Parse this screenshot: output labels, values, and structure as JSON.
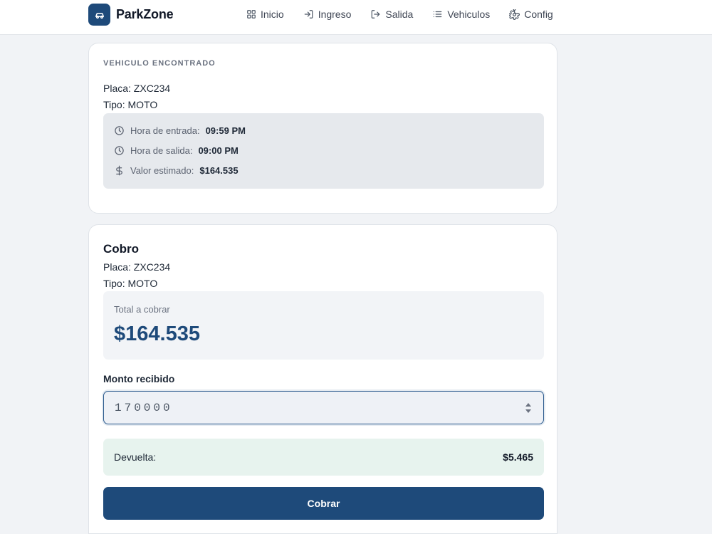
{
  "app": {
    "name": "ParkZone"
  },
  "nav": [
    {
      "label": "Inicio",
      "icon": "grid-icon"
    },
    {
      "label": "Ingreso",
      "icon": "login-arrow-icon"
    },
    {
      "label": "Salida",
      "icon": "logout-arrow-icon"
    },
    {
      "label": "Vehiculos",
      "icon": "list-icon"
    },
    {
      "label": "Config",
      "icon": "gear-icon"
    }
  ],
  "vehicle": {
    "eyebrow": "VEHICULO ENCONTRADO",
    "plate": "Placa: ZXC234",
    "type": "Tipo: MOTO",
    "entry_label": "Hora de entrada:",
    "entry_value": "09:59 PM",
    "exit_label": "Hora de salida:",
    "exit_value": "09:00 PM",
    "estimate_label": "Valor estimado:",
    "estimate_value": "$164.535"
  },
  "payment": {
    "title": "Cobro",
    "plate": "Placa: ZXC234",
    "type": "Tipo: MOTO",
    "total_label": "Total a cobrar",
    "total_value": "$164.535",
    "received_label": "Monto recibido",
    "received_value": "170000",
    "change_label": "Devuelta:",
    "change_value": "$5.465",
    "submit_label": "Cobrar"
  },
  "colors": {
    "primary": "#1e4a7a",
    "page_bg": "#f1f3f6",
    "info_bg": "#e6e9ed",
    "change_bg": "#e7f3ee"
  }
}
